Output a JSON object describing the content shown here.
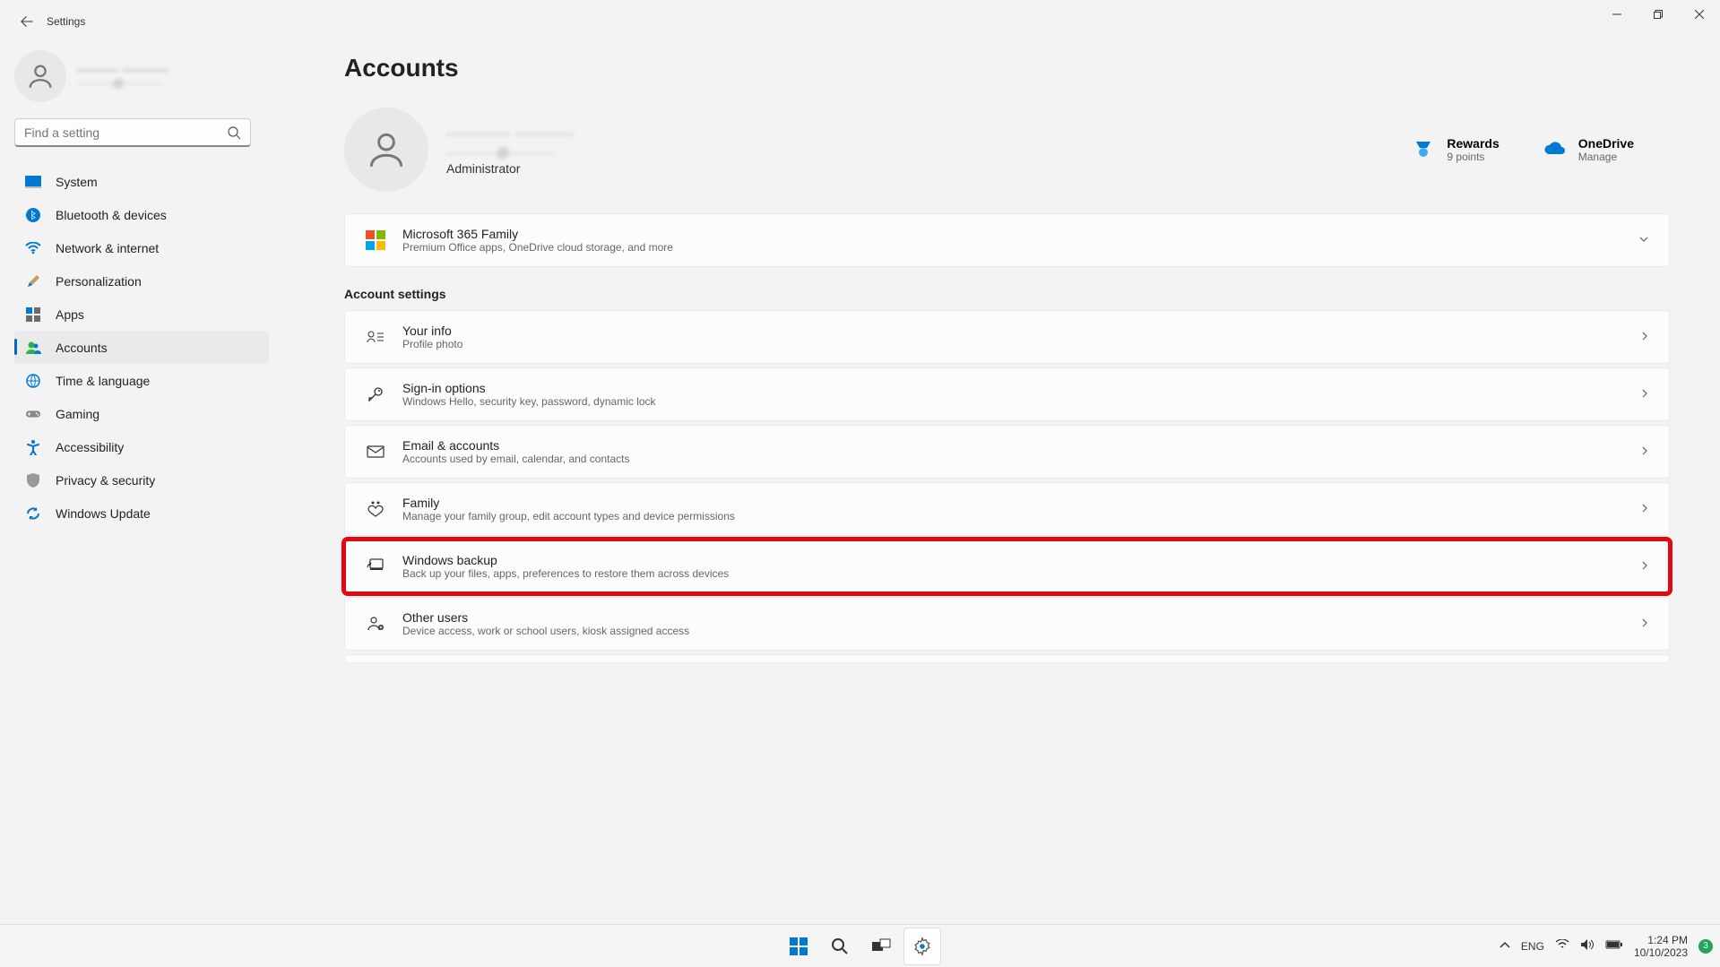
{
  "window": {
    "title": "Settings"
  },
  "sidebar_user": {
    "name": "·········· ···········",
    "email": "··········@···········"
  },
  "search": {
    "placeholder": "Find a setting"
  },
  "nav": {
    "items": [
      {
        "label": "System"
      },
      {
        "label": "Bluetooth & devices"
      },
      {
        "label": "Network & internet"
      },
      {
        "label": "Personalization"
      },
      {
        "label": "Apps"
      },
      {
        "label": "Accounts"
      },
      {
        "label": "Time & language"
      },
      {
        "label": "Gaming"
      },
      {
        "label": "Accessibility"
      },
      {
        "label": "Privacy & security"
      },
      {
        "label": "Windows Update"
      }
    ]
  },
  "page": {
    "title": "Accounts",
    "account_name": "············ ···········",
    "account_email": "············@···········",
    "account_role": "Administrator"
  },
  "tiles": {
    "rewards_title": "Rewards",
    "rewards_sub": "9 points",
    "onedrive_title": "OneDrive",
    "onedrive_sub": "Manage"
  },
  "ms365": {
    "title": "Microsoft 365 Family",
    "sub": "Premium Office apps, OneDrive cloud storage, and more"
  },
  "section_label": "Account settings",
  "settings": [
    {
      "title": "Your info",
      "sub": "Profile photo",
      "icon": "person-card"
    },
    {
      "title": "Sign-in options",
      "sub": "Windows Hello, security key, password, dynamic lock",
      "icon": "key"
    },
    {
      "title": "Email & accounts",
      "sub": "Accounts used by email, calendar, and contacts",
      "icon": "mail"
    },
    {
      "title": "Family",
      "sub": "Manage your family group, edit account types and device permissions",
      "icon": "heart-people"
    },
    {
      "title": "Windows backup",
      "sub": "Back up your files, apps, preferences to restore them across devices",
      "icon": "backup",
      "highlight": true
    },
    {
      "title": "Other users",
      "sub": "Device access, work or school users, kiosk assigned access",
      "icon": "person-add"
    }
  ],
  "taskbar": {
    "lang": "ENG",
    "time": "1:24 PM",
    "date": "10/10/2023",
    "notification_count": "3"
  }
}
